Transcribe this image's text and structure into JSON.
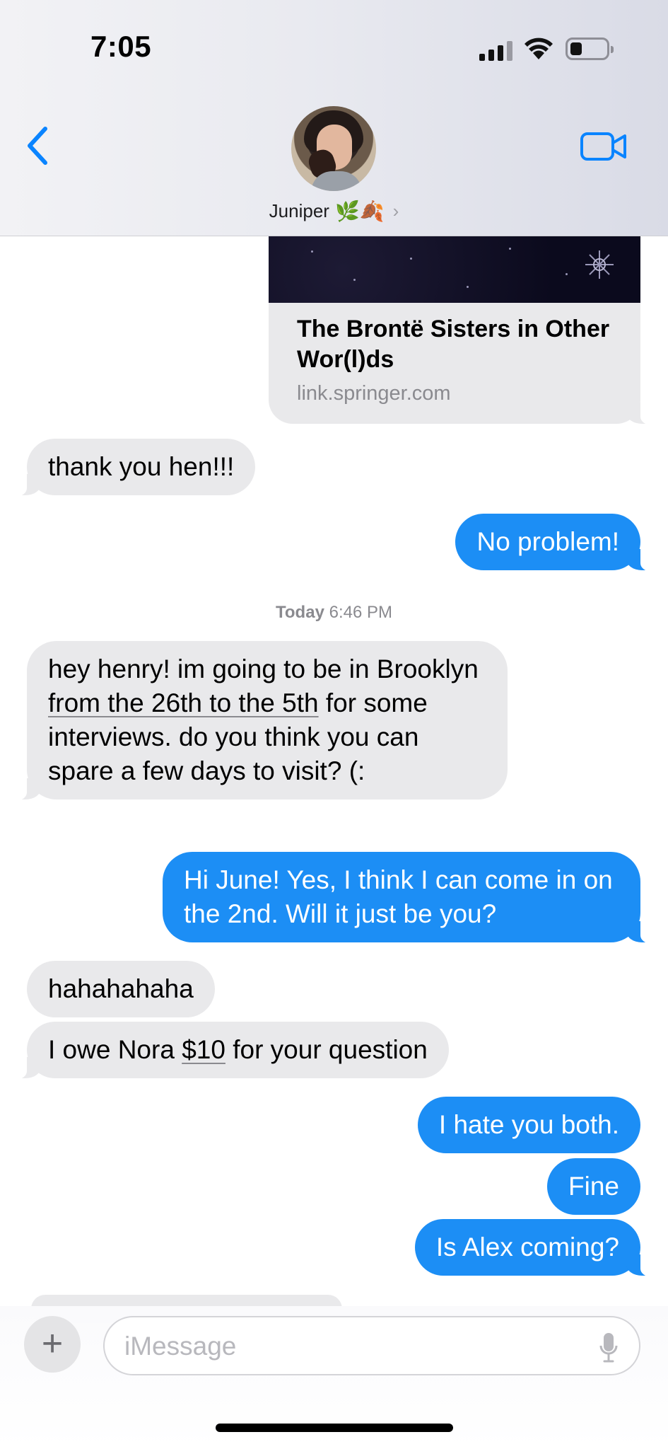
{
  "status_bar": {
    "time": "7:05"
  },
  "header": {
    "contact_name": "Juniper",
    "contact_emoji": "🌿🍂",
    "back_icon": "chevron-left-icon",
    "video_icon": "video-camera-icon"
  },
  "link_preview": {
    "title": "The Brontë Sisters in Other Wor(l)ds",
    "domain": "link.springer.com"
  },
  "messages": [
    {
      "dir": "in",
      "text": "thank you hen!!!"
    },
    {
      "dir": "out",
      "text": "No problem!"
    },
    {
      "dir": "in",
      "pre": "hey henry! im going to be in Brooklyn ",
      "link": "from the 26th to the 5th",
      "post": " for some interviews. do you think you can spare a few days to visit? (:"
    },
    {
      "dir": "out",
      "text": "Hi June! Yes, I think I can come in on the 2nd. Will it just be you?"
    },
    {
      "dir": "in",
      "text": "hahahahaha"
    },
    {
      "dir": "in",
      "pre": "I owe Nora ",
      "link": "$10",
      "post": " for your question"
    },
    {
      "dir": "out",
      "text": "I hate you both."
    },
    {
      "dir": "out",
      "text": "Fine"
    },
    {
      "dir": "out",
      "text": "Is Alex coming?"
    }
  ],
  "timestamp": {
    "day": "Today",
    "time": "6:46 PM"
  },
  "composer": {
    "placeholder": "iMessage",
    "plus_label": "+"
  },
  "colors": {
    "outgoing": "#1c8ef5",
    "incoming": "#e9e9eb",
    "accent": "#0a84ff"
  }
}
